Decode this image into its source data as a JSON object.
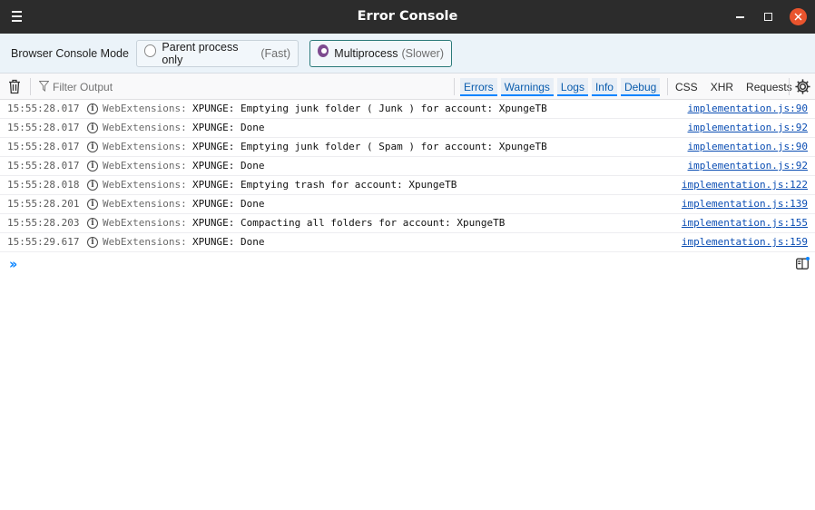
{
  "window": {
    "title": "Error Console"
  },
  "mode": {
    "label": "Browser Console Mode",
    "options": [
      {
        "label": "Parent process only",
        "hint": "(Fast)",
        "selected": false
      },
      {
        "label": "Multiprocess",
        "hint": "(Slower)",
        "selected": true
      }
    ]
  },
  "toolbar": {
    "filter_placeholder": "Filter Output",
    "level_filters": [
      "Errors",
      "Warnings",
      "Logs",
      "Info",
      "Debug"
    ],
    "type_filters": [
      "CSS",
      "XHR",
      "Requests"
    ]
  },
  "messages": [
    {
      "time": "15:55:28.017",
      "prefix": "WebExtensions:",
      "text": "XPUNGE: Emptying junk folder ( Junk ) for account: XpungeTB",
      "source": "implementation.js:90"
    },
    {
      "time": "15:55:28.017",
      "prefix": "WebExtensions:",
      "text": "XPUNGE: Done",
      "source": "implementation.js:92"
    },
    {
      "time": "15:55:28.017",
      "prefix": "WebExtensions:",
      "text": "XPUNGE: Emptying junk folder ( Spam ) for account: XpungeTB",
      "source": "implementation.js:90"
    },
    {
      "time": "15:55:28.017",
      "prefix": "WebExtensions:",
      "text": "XPUNGE: Done",
      "source": "implementation.js:92"
    },
    {
      "time": "15:55:28.018",
      "prefix": "WebExtensions:",
      "text": "XPUNGE: Emptying trash for account: XpungeTB",
      "source": "implementation.js:122"
    },
    {
      "time": "15:55:28.201",
      "prefix": "WebExtensions:",
      "text": "XPUNGE: Done",
      "source": "implementation.js:139"
    },
    {
      "time": "15:55:28.203",
      "prefix": "WebExtensions:",
      "text": "XPUNGE: Compacting all folders for account: XpungeTB",
      "source": "implementation.js:155"
    },
    {
      "time": "15:55:29.617",
      "prefix": "WebExtensions:",
      "text": "XPUNGE: Done",
      "source": "implementation.js:159"
    }
  ],
  "prompt": {
    "value": ""
  },
  "colors": {
    "accent": "#0a84ff",
    "close_button": "#e9542d",
    "radio_selected": "#7d4a8f",
    "titlebar": "#2c2c2c"
  }
}
